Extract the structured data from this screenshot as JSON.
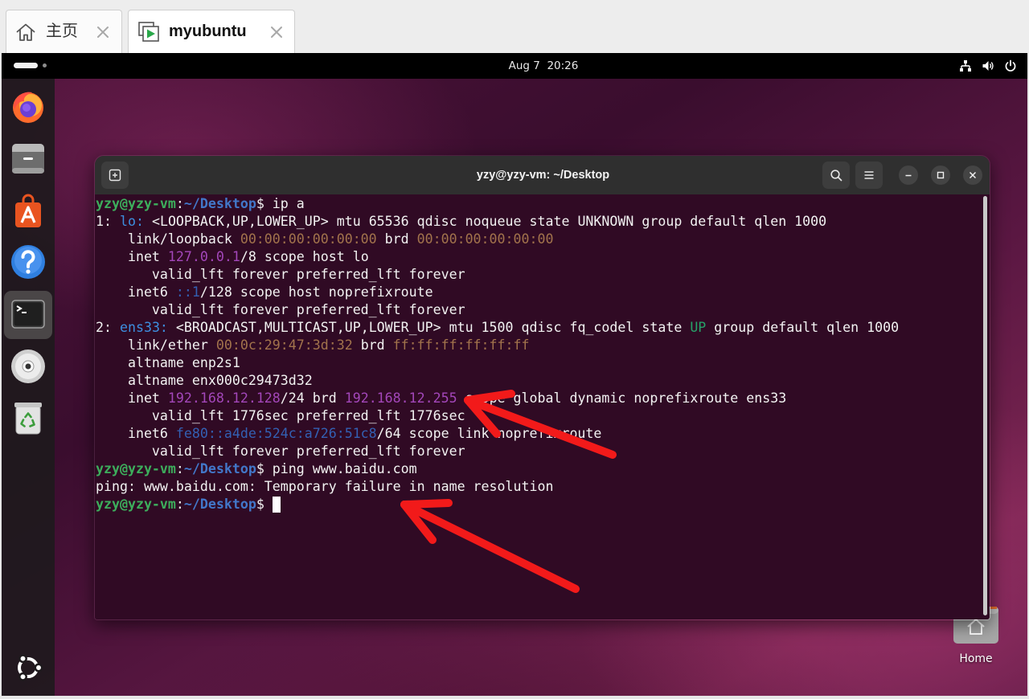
{
  "tabs": [
    {
      "label": "主页",
      "icon": "home-icon"
    },
    {
      "label": "myubuntu",
      "icon": "virtual-machine-icon",
      "active": true
    }
  ],
  "topbar": {
    "clock": "Aug 7  20:26",
    "status_icons": [
      "network-icon",
      "volume-icon",
      "power-icon"
    ]
  },
  "dock": {
    "items": [
      {
        "icon": "firefox-icon"
      },
      {
        "icon": "files-icon"
      },
      {
        "icon": "app-center-icon"
      },
      {
        "icon": "help-icon"
      },
      {
        "icon": "terminal-icon",
        "active": true
      },
      {
        "icon": "dvd-icon"
      },
      {
        "icon": "trash-icon"
      }
    ],
    "show_apps_icon": "ubuntu-logo-icon"
  },
  "desktop": {
    "home_label": "Home",
    "home_icon": "home-folder-icon"
  },
  "terminal": {
    "title": "yzy@yzy-vm: ~/Desktop",
    "palette": {
      "background": "#300a24",
      "plain": "#f2f2f2",
      "user": "#3dae5c",
      "path": "#4277c9",
      "iface": "#3d8fe0",
      "addr": "#a347ba",
      "addr6": "#3360b3",
      "mac": "#a2734c",
      "state": "#26a269"
    },
    "lines": [
      [
        {
          "style": "user",
          "text": "yzy@yzy-vm"
        },
        {
          "style": "plain",
          "text": ":"
        },
        {
          "style": "path",
          "text": "~/Desktop"
        },
        {
          "style": "plain",
          "text": "$ ip a"
        }
      ],
      [
        {
          "style": "plain",
          "text": "1: "
        },
        {
          "style": "iface",
          "text": "lo:"
        },
        {
          "style": "plain",
          "text": " <LOOPBACK,UP,LOWER_UP> mtu 65536 qdisc noqueue state UNKNOWN group default qlen 1000"
        }
      ],
      [
        {
          "style": "plain",
          "text": "    link/loopback "
        },
        {
          "style": "mac",
          "text": "00:00:00:00:00:00"
        },
        {
          "style": "plain",
          "text": " brd "
        },
        {
          "style": "mac",
          "text": "00:00:00:00:00:00"
        }
      ],
      [
        {
          "style": "plain",
          "text": "    inet "
        },
        {
          "style": "addr",
          "text": "127.0.0.1"
        },
        {
          "style": "plain",
          "text": "/8 scope host lo"
        }
      ],
      [
        {
          "style": "plain",
          "text": "       valid_lft forever preferred_lft forever"
        }
      ],
      [
        {
          "style": "plain",
          "text": "    inet6 "
        },
        {
          "style": "addr6",
          "text": "::1"
        },
        {
          "style": "plain",
          "text": "/128 scope host noprefixroute"
        }
      ],
      [
        {
          "style": "plain",
          "text": "       valid_lft forever preferred_lft forever"
        }
      ],
      [
        {
          "style": "plain",
          "text": "2: "
        },
        {
          "style": "iface",
          "text": "ens33:"
        },
        {
          "style": "plain",
          "text": " <BROADCAST,MULTICAST,UP,LOWER_UP> mtu 1500 qdisc fq_codel state "
        },
        {
          "style": "state",
          "text": "UP"
        },
        {
          "style": "plain",
          "text": " group default qlen 1000"
        }
      ],
      [
        {
          "style": "plain",
          "text": "    link/ether "
        },
        {
          "style": "mac",
          "text": "00:0c:29:47:3d:32"
        },
        {
          "style": "plain",
          "text": " brd "
        },
        {
          "style": "mac",
          "text": "ff:ff:ff:ff:ff:ff"
        }
      ],
      [
        {
          "style": "plain",
          "text": "    altname enp2s1"
        }
      ],
      [
        {
          "style": "plain",
          "text": "    altname enx000c29473d32"
        }
      ],
      [
        {
          "style": "plain",
          "text": "    inet "
        },
        {
          "style": "addr",
          "text": "192.168.12.128"
        },
        {
          "style": "plain",
          "text": "/24 brd "
        },
        {
          "style": "addr",
          "text": "192.168.12.255"
        },
        {
          "style": "plain",
          "text": " scope global dynamic noprefixroute ens33"
        }
      ],
      [
        {
          "style": "plain",
          "text": "       valid_lft 1776sec preferred_lft 1776sec"
        }
      ],
      [
        {
          "style": "plain",
          "text": "    inet6 "
        },
        {
          "style": "addr6",
          "text": "fe80::a4de:524c:a726:51c8"
        },
        {
          "style": "plain",
          "text": "/64 scope link noprefixroute"
        }
      ],
      [
        {
          "style": "plain",
          "text": "       valid_lft forever preferred_lft forever"
        }
      ],
      [
        {
          "style": "user",
          "text": "yzy@yzy-vm"
        },
        {
          "style": "plain",
          "text": ":"
        },
        {
          "style": "path",
          "text": "~/Desktop"
        },
        {
          "style": "plain",
          "text": "$ ping www.baidu.com"
        }
      ],
      [
        {
          "style": "plain",
          "text": "ping: www.baidu.com: Temporary failure in name resolution"
        }
      ],
      [
        {
          "style": "user",
          "text": "yzy@yzy-vm"
        },
        {
          "style": "plain",
          "text": ":"
        },
        {
          "style": "path",
          "text": "~/Desktop"
        },
        {
          "style": "plain",
          "text": "$ "
        }
      ]
    ]
  },
  "annotations": {
    "color": "#f21a1a"
  }
}
